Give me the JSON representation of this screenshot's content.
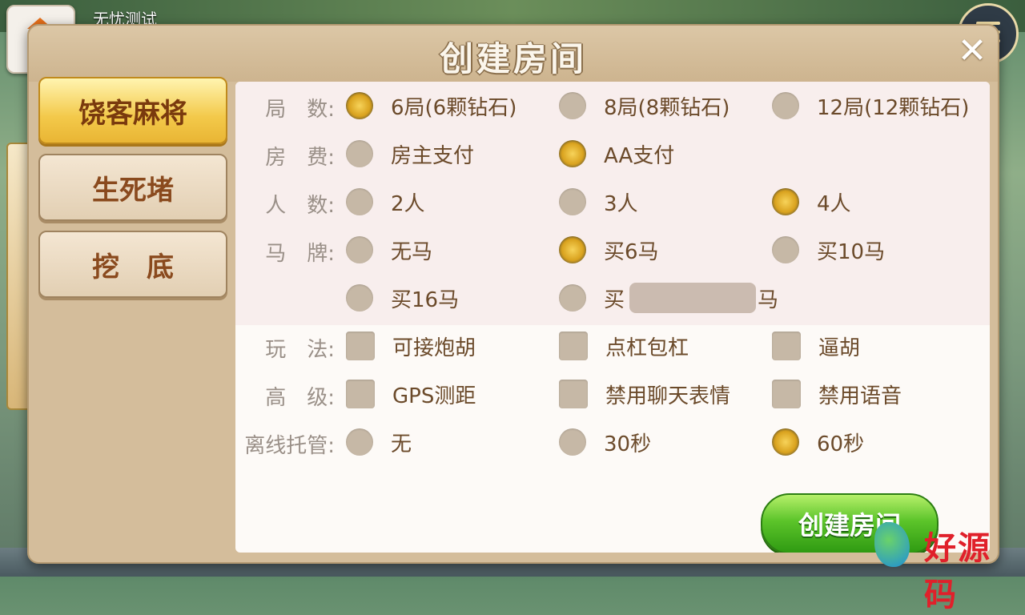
{
  "background": {
    "lobby_title": "无忧测试",
    "watermark_text": "好源码"
  },
  "modal": {
    "title": "创建房间",
    "close_label": "✕"
  },
  "sidebar": {
    "items": [
      {
        "label": "饶客麻将",
        "active": true
      },
      {
        "label": "生死堵",
        "active": false
      },
      {
        "label": "挖　底",
        "active": false
      }
    ]
  },
  "settings": {
    "rounds": {
      "label": "局　数:",
      "options": [
        "6局(6颗钻石)",
        "8局(8颗钻石)",
        "12局(12颗钻石)"
      ],
      "selected": 0
    },
    "fee": {
      "label": "房　费:",
      "options": [
        "房主支付",
        "AA支付"
      ],
      "selected": 1
    },
    "players": {
      "label": "人　数:",
      "options": [
        "2人",
        "3人",
        "4人"
      ],
      "selected": 2
    },
    "horse": {
      "label": "马　牌:",
      "options": [
        "无马",
        "买6马",
        "买10马",
        "买16马"
      ],
      "selected": 1,
      "custom_prefix": "买",
      "custom_suffix": "马",
      "custom_value": ""
    },
    "play": {
      "label": "玩　法:",
      "options": [
        "可接炮胡",
        "点杠包杠",
        "逼胡"
      ]
    },
    "advanced": {
      "label": "高　级:",
      "options": [
        "GPS测距",
        "禁用聊天表情",
        "禁用语音"
      ]
    },
    "offline": {
      "label": "离线托管:",
      "options": [
        "无",
        "30秒",
        "60秒"
      ],
      "selected": 2
    }
  },
  "create_button_label": "创建房间",
  "colors": {
    "accent_gold": "#e9b534",
    "button_green": "#5cc42a",
    "panel_bg": "#fdfaf7"
  }
}
